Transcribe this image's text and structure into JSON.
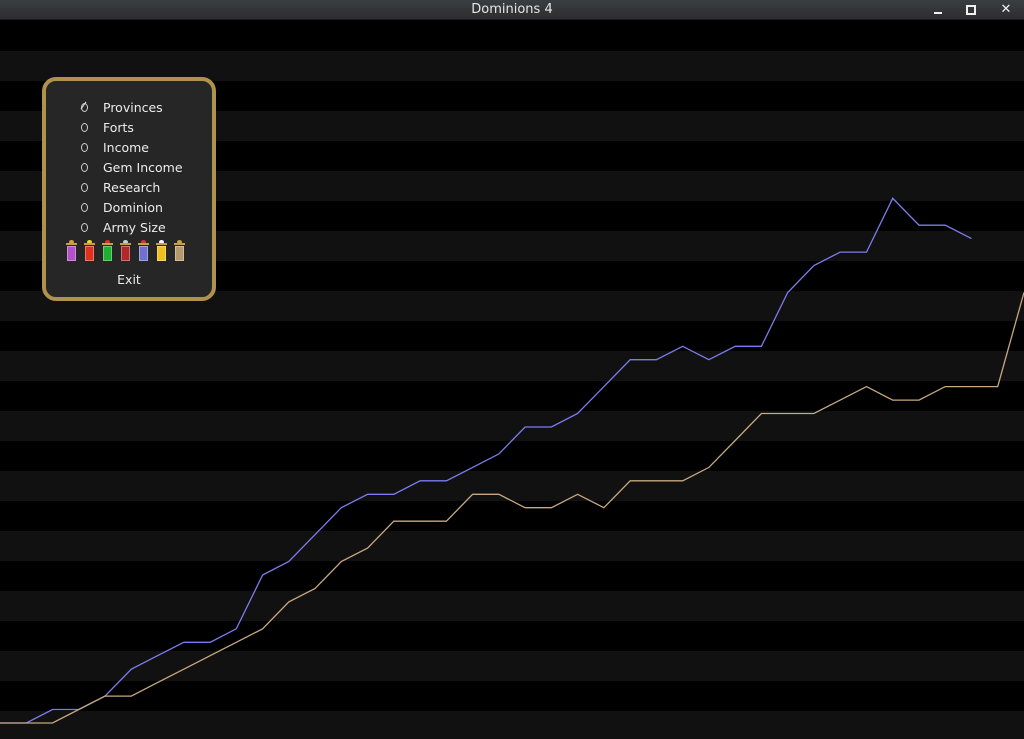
{
  "window": {
    "title": "Dominions 4",
    "controls": [
      "minimize",
      "maximize",
      "close"
    ]
  },
  "menu": {
    "options": [
      {
        "label": "Provinces",
        "selected": true
      },
      {
        "label": "Forts",
        "selected": false
      },
      {
        "label": "Income",
        "selected": false
      },
      {
        "label": "Gem Income",
        "selected": false
      },
      {
        "label": "Research",
        "selected": false
      },
      {
        "label": "Dominion",
        "selected": false
      },
      {
        "label": "Army Size",
        "selected": false
      }
    ],
    "banners": [
      {
        "color": "#b450c8",
        "top": "#e0a030"
      },
      {
        "color": "#e03020",
        "top": "#f0d040"
      },
      {
        "color": "#20b030",
        "top": "#e03020"
      },
      {
        "color": "#b02828",
        "top": "#d0d0d0"
      },
      {
        "color": "#7070d0",
        "top": "#e03030"
      },
      {
        "color": "#f0c020",
        "top": "#ffffff"
      },
      {
        "color": "#b49a6a",
        "top": "#d0a030"
      }
    ],
    "exit_label": "Exit"
  },
  "colors": {
    "panel_border": "#b1924d",
    "stripe": "#111111"
  },
  "chart_data": {
    "type": "line",
    "metric": "Provinces",
    "x": [
      0,
      1,
      2,
      3,
      4,
      5,
      6,
      7,
      8,
      9,
      10,
      11,
      12,
      13,
      14,
      15,
      16,
      17,
      18,
      19,
      20,
      21,
      22,
      23,
      24,
      25,
      26,
      27,
      28,
      29,
      30,
      31,
      32,
      33,
      34,
      35,
      36,
      37,
      38,
      39
    ],
    "series": [
      {
        "color": "#7c7cf0",
        "values": [
          0,
          0,
          1,
          1,
          2,
          4,
          5,
          6,
          6,
          7,
          11,
          12,
          14,
          16,
          17,
          17,
          18,
          18,
          19,
          20,
          22,
          22,
          23,
          25,
          27,
          27,
          28,
          27,
          28,
          28,
          32,
          34,
          35,
          35,
          39,
          37,
          37,
          36
        ]
      },
      {
        "color": "#c8a880",
        "values": [
          0,
          0,
          0,
          1,
          2,
          2,
          3,
          4,
          5,
          6,
          7,
          9,
          10,
          12,
          13,
          15,
          15,
          15,
          17,
          17,
          16,
          16,
          17,
          16,
          18,
          18,
          18,
          19,
          21,
          23,
          23,
          23,
          24,
          25,
          24,
          24,
          25,
          25,
          25,
          32
        ]
      }
    ],
    "ylim": [
      0,
      44
    ],
    "grid": "horizontal stripes",
    "legend": "none"
  }
}
